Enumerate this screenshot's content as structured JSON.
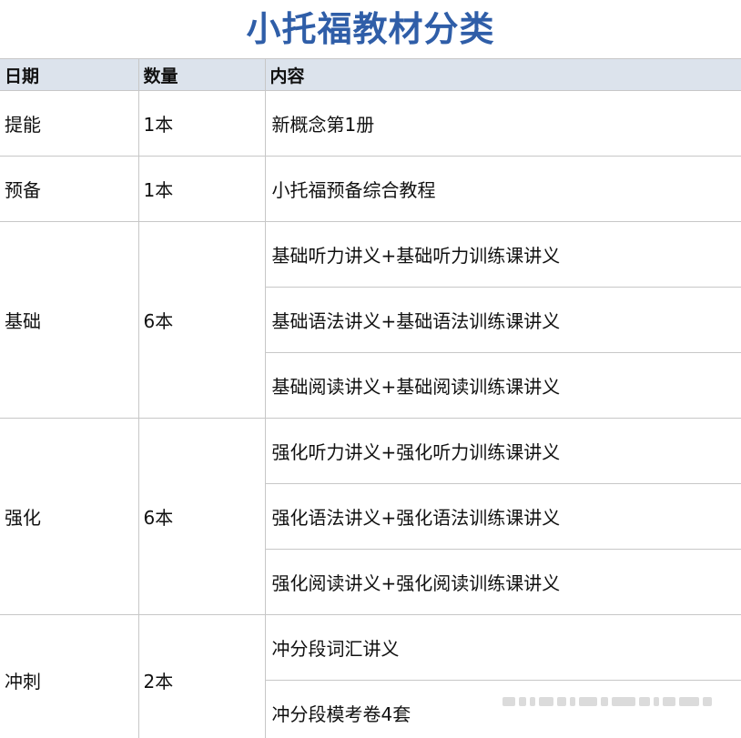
{
  "title": "小托福教材分类",
  "table": {
    "headers": [
      "日期",
      "数量",
      "内容"
    ],
    "groups": [
      {
        "stage": "提能",
        "count": "1本",
        "items": [
          "新概念第1册"
        ]
      },
      {
        "stage": "预备",
        "count": "1本",
        "items": [
          "小托福预备综合教程"
        ]
      },
      {
        "stage": "基础",
        "count": "6本",
        "items": [
          "基础听力讲义+基础听力训练课讲义",
          "基础语法讲义+基础语法训练课讲义",
          "基础阅读讲义+基础阅读训练课讲义"
        ]
      },
      {
        "stage": "强化",
        "count": "6本",
        "items": [
          "强化听力讲义+强化听力训练课讲义",
          "强化语法讲义+强化语法训练课讲义",
          "强化阅读讲义+强化阅读训练课讲义"
        ]
      },
      {
        "stage": "冲刺",
        "count": "2本",
        "items": [
          "冲分段词汇讲义",
          "冲分段模考卷4套"
        ]
      }
    ]
  },
  "colors": {
    "title": "#2f5ea8",
    "header_bg": "#dce3ec",
    "border": "#c7c7c7"
  }
}
